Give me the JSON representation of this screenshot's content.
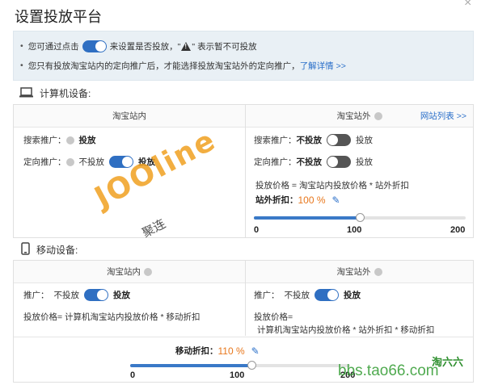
{
  "header": {
    "title": "设置投放平台",
    "close_glyph": "×"
  },
  "notice": {
    "line1_prefix": "您可通过点击",
    "line1_mid": "来设置是否投放，\"",
    "line1_suffix": "\" 表示暂不可投放",
    "line2_text": "您只有投放淘宝站内的定向推广后，才能选择投放淘宝站外的定向推广，",
    "line2_link": "了解详情 >>"
  },
  "pc": {
    "label": "计算机设备:",
    "inside": {
      "header": "淘宝站内",
      "search_label": "搜索推广：",
      "search_value": "投放",
      "target_label": "定向推广：",
      "target_off": "不投放",
      "target_on": "投放"
    },
    "outside": {
      "header": "淘宝站外",
      "site_list_link": "网站列表 >>",
      "search_label": "搜索推广：",
      "search_off": "不投放",
      "search_on": "投放",
      "target_label": "定向推广：",
      "target_off": "不投放",
      "target_on": "投放",
      "price_formula": "投放价格 = 淘宝站内投放价格 * 站外折扣",
      "discount_label": "站外折扣：",
      "discount_value": "100 %",
      "slider_value_pct": 50,
      "ticks": [
        "0",
        "100",
        "200"
      ]
    }
  },
  "mobile": {
    "label": "移动设备:",
    "inside": {
      "header": "淘宝站内",
      "promo_label": "推广：",
      "promo_off": "不投放",
      "promo_on": "投放",
      "price_formula": "投放价格= 计算机淘宝站内投放价格 * 移动折扣"
    },
    "outside": {
      "header": "淘宝站外",
      "promo_label": "推广：",
      "promo_off": "不投放",
      "promo_on": "投放",
      "price_line1": "投放价格=",
      "price_line2": "计算机淘宝站内投放价格 * 站外折扣 * 移动折扣"
    },
    "discount_label": "移动折扣：",
    "discount_value": "110 %",
    "slider_value_pct": 55,
    "ticks": [
      "0",
      "100",
      "200"
    ]
  },
  "watermarks": {
    "brand": "JOOline",
    "brand_cn": "聚连",
    "site": "bbs.tao66.com",
    "site_cn": "淘六六"
  }
}
